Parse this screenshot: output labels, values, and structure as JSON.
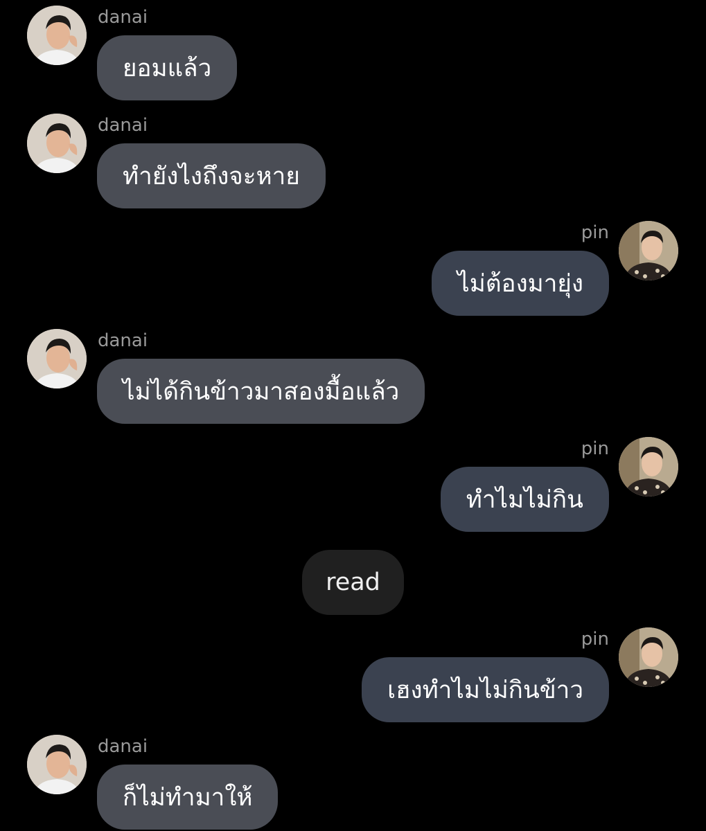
{
  "messages": [
    {
      "sender": "danai",
      "text": "ยอมแล้ว"
    },
    {
      "sender": "danai",
      "text": "ทำยังไงถึงจะหาย"
    },
    {
      "sender": "pin",
      "text": "ไม่ต้องมายุ่ง"
    },
    {
      "sender": "danai",
      "text": "ไม่ได้กินข้าวมาสองมื้อแล้ว"
    },
    {
      "sender": "pin",
      "text": "ทำไมไม่กิน"
    },
    {
      "sender": "pin",
      "text": "เฮงทำไมไม่กินข้าว"
    },
    {
      "sender": "danai",
      "text": "ก็ไม่ทำมาให้"
    }
  ],
  "status": {
    "label": "read"
  },
  "colors": {
    "background": "#000000",
    "incoming_bubble": "#4a4d55",
    "outgoing_bubble": "#3b4250",
    "status_bubble": "#202020",
    "sender_name": "#9a9a9a",
    "text": "#ffffff"
  },
  "icons": {
    "danai_avatar": "avatar-danai",
    "pin_avatar": "avatar-pin"
  }
}
